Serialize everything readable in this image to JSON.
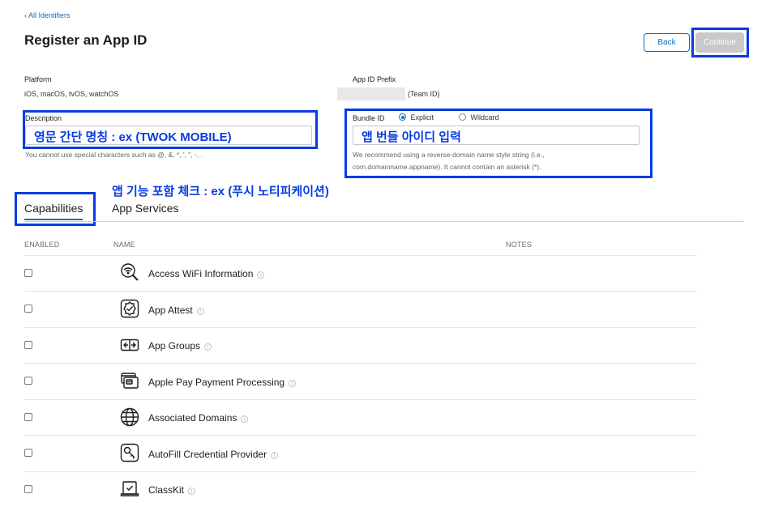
{
  "breadcrumb": "‹ All Identifiers",
  "title": "Register an App ID",
  "buttons": {
    "back": "Back",
    "continue": "Continue"
  },
  "platform": {
    "label": "Platform",
    "value": "iOS, macOS, tvOS, watchOS"
  },
  "app_id_prefix": {
    "label": "App ID Prefix",
    "value": "(Team ID)"
  },
  "description": {
    "label": "Description",
    "value": "영문 간단 명칭 : ex (TWOK MOBILE)",
    "help": "You cannot use special characters such as @, &, *, ', \", -, ."
  },
  "bundle_id": {
    "label": "Bundle ID",
    "options": [
      "Explicit",
      "Wildcard"
    ],
    "selected": "Explicit",
    "value": "앱 번들 아이디 입력",
    "help_line1": "We recommend using a reverse-domain name style string (i.e.,",
    "help_line2": "com.domainname.appname). It cannot contain an asterisk (*)."
  },
  "annotation_capabilities": "앱 기능 포함 체크 : ex (푸시 노티피케이션)",
  "tabs": [
    "Capabilities",
    "App Services"
  ],
  "columns": {
    "enabled": "ENABLED",
    "name": "NAME",
    "notes": "NOTES"
  },
  "capabilities": [
    {
      "name": "Access WiFi Information",
      "icon": "wifi-search-icon",
      "enabled": false
    },
    {
      "name": "App Attest",
      "icon": "badge-check-icon",
      "enabled": false
    },
    {
      "name": "App Groups",
      "icon": "app-groups-icon",
      "enabled": false
    },
    {
      "name": "Apple Pay Payment Processing",
      "icon": "payment-cards-icon",
      "enabled": false
    },
    {
      "name": "Associated Domains",
      "icon": "globe-icon",
      "enabled": false
    },
    {
      "name": "AutoFill Credential Provider",
      "icon": "key-icon",
      "enabled": false
    },
    {
      "name": "ClassKit",
      "icon": "classkit-icon",
      "enabled": false
    }
  ],
  "colors": {
    "accent": "#0070c9",
    "annotation": "#0a3be0",
    "disabled_button": "#c9c9c9"
  }
}
